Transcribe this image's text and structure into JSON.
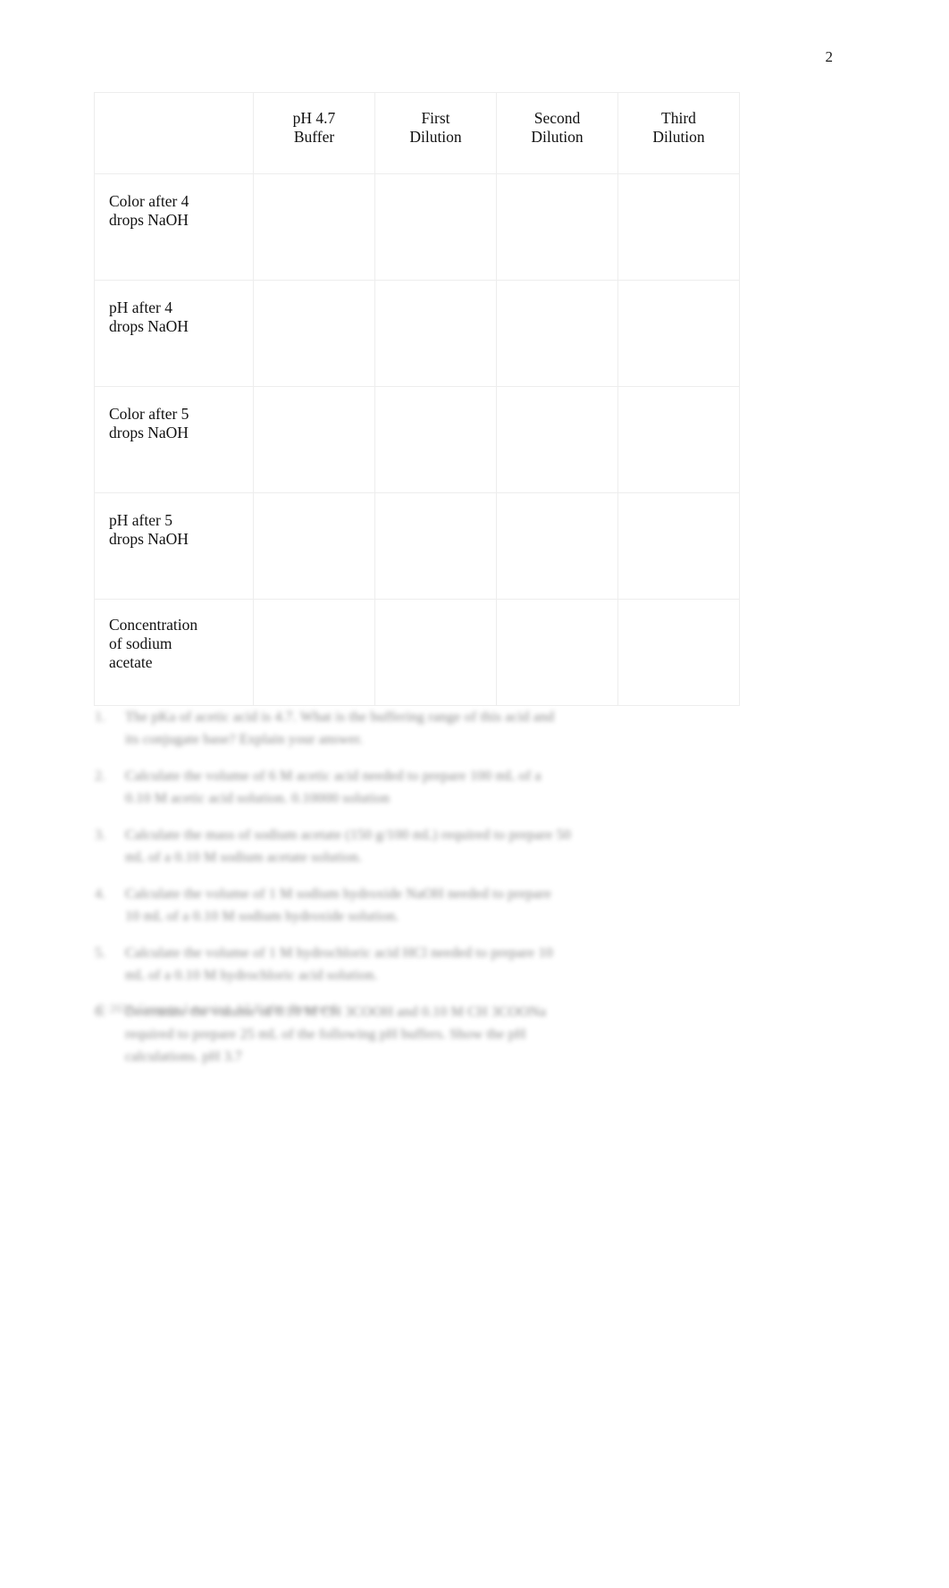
{
  "document": {
    "page_number": "2"
  },
  "table": {
    "headers": [
      {
        "lines": [
          ""
        ]
      },
      {
        "lines": [
          "pH 4.7",
          "Buffer"
        ]
      },
      {
        "lines": [
          "First",
          "Dilution"
        ]
      },
      {
        "lines": [
          "Second",
          "Dilution"
        ]
      },
      {
        "lines": [
          "Third",
          "Dilution"
        ]
      }
    ],
    "rows": [
      {
        "label_lines": [
          "Color after 4",
          "drops NaOH"
        ],
        "cells": [
          "",
          "",
          "",
          ""
        ]
      },
      {
        "label_lines": [
          "pH after 4",
          "drops NaOH"
        ],
        "cells": [
          "",
          "",
          "",
          ""
        ]
      },
      {
        "label_lines": [
          "Color after 5",
          "drops NaOH"
        ],
        "cells": [
          "",
          "",
          "",
          ""
        ]
      },
      {
        "label_lines": [
          "pH after 5",
          "drops NaOH"
        ],
        "cells": [
          "",
          "",
          "",
          ""
        ]
      },
      {
        "label_lines": [
          "Concentration",
          "of sodium",
          "acetate"
        ],
        "cells": [
          "",
          "",
          "",
          ""
        ]
      }
    ]
  },
  "questions": [
    {
      "number": "1.",
      "lines": [
        "The pKa of acetic acid is 4.7. What is the buffering range of this acid and",
        "its conjugate base? Explain your answer."
      ]
    },
    {
      "number": "2.",
      "lines": [
        "Calculate the volume of 6 M acetic acid needed to prepare 100 mL of a",
        "0.10 M acetic acid solution.        0.10000 solution"
      ]
    },
    {
      "number": "3.",
      "lines": [
        "Calculate the mass of sodium acetate (150            g/100 mL) required to prepare 50",
        "mL of a 0.10 M sodium acetate solution."
      ]
    },
    {
      "number": "4.",
      "lines": [
        "Calculate the volume of 1 M sodium hydroxide NaOH needed to prepare",
        "10 mL of a 0.10 M sodium hydroxide solution."
      ]
    },
    {
      "number": "5.",
      "lines": [
        "Calculate the volume of 1 M hydrochloric acid HCl needed to prepare 10",
        "mL of a 0.10 M hydrochloric acid solution."
      ]
    },
    {
      "number": "6.",
      "lines": [
        "Determine the volume of 0.10 M CH            3COOH and 0.10 M CH            3COONa",
        "required to prepare 25 mL of the following pH buffers. Show the pH",
        "calculations.     pH 3.7"
      ]
    }
  ],
  "footer": {
    "text": "© 2021 Cengage Learning. All Rights Reserved."
  }
}
